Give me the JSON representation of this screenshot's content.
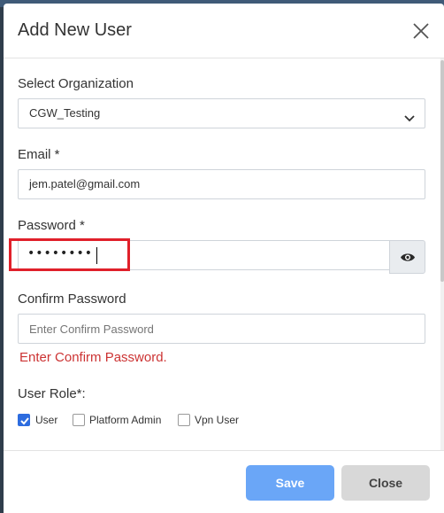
{
  "modal": {
    "title": "Add New User",
    "close_icon": "close-icon"
  },
  "form": {
    "organization": {
      "label": "Select Organization",
      "selected": "CGW_Testing",
      "icon": "chevron-down-icon"
    },
    "email": {
      "label": "Email *",
      "value": "jem.patel@gmail.com"
    },
    "password": {
      "label": "Password *",
      "masked_value": "••••••••",
      "toggle_icon": "eye-icon"
    },
    "confirm_password": {
      "label": "Confirm Password",
      "placeholder": "Enter Confirm Password",
      "error": "Enter Confirm Password."
    },
    "user_role": {
      "label": "User Role*:",
      "options": [
        {
          "label": "User",
          "checked": true
        },
        {
          "label": "Platform Admin",
          "checked": false
        },
        {
          "label": "Vpn User",
          "checked": false
        }
      ]
    }
  },
  "footer": {
    "save_label": "Save",
    "close_label": "Close"
  },
  "colors": {
    "primary": "#6aa6f7",
    "checkbox_checked": "#2d6cdf",
    "error": "#cc3333",
    "highlight": "#e0202a"
  }
}
